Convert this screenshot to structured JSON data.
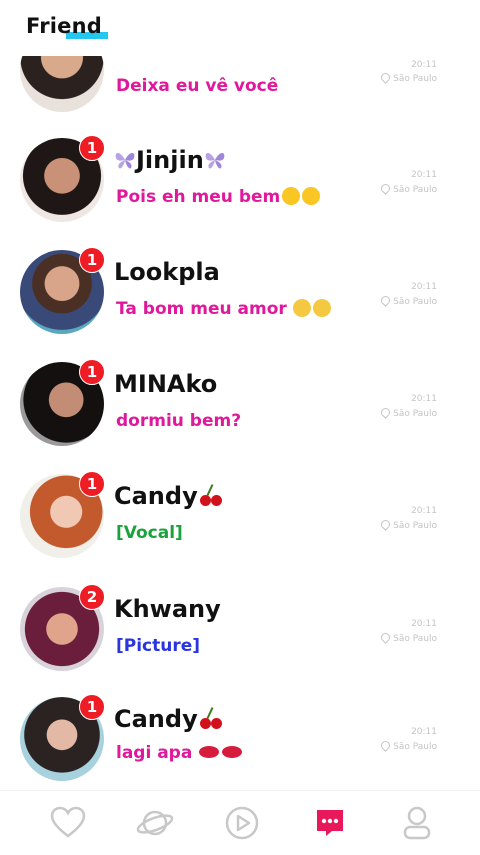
{
  "header": {
    "title": "Friend"
  },
  "conversations": [
    {
      "name": "",
      "message": "Deixa eu vê você",
      "message_color": "#e0189c",
      "time": "20:11",
      "location": "São Paulo",
      "badge": ""
    },
    {
      "name": "Jinjin",
      "message": "Pois eh meu bem",
      "message_color": "#e0189c",
      "time": "20:11",
      "location": "São Paulo",
      "badge": "1"
    },
    {
      "name": "Lookpla",
      "message": "Ta bom meu amor",
      "message_color": "#e0189c",
      "time": "20:11",
      "location": "São Paulo",
      "badge": "1"
    },
    {
      "name": "MINAko",
      "message": "dormiu bem?",
      "message_color": "#e0189c",
      "time": "20:11",
      "location": "São Paulo",
      "badge": "1"
    },
    {
      "name": "Candy",
      "message": "[Vocal]",
      "message_color": "#1aa33c",
      "time": "20:11",
      "location": "São Paulo",
      "badge": "1"
    },
    {
      "name": "Khwany",
      "message": "[Picture]",
      "message_color": "#2a35e0",
      "time": "20:11",
      "location": "São Paulo",
      "badge": "2"
    },
    {
      "name": "Candy",
      "message": "lagi apa",
      "message_color": "#e0189c",
      "time": "20:11",
      "location": "São Paulo",
      "badge": "1"
    }
  ],
  "tabbar": {
    "items": [
      {
        "icon": "heart-icon",
        "active": false
      },
      {
        "icon": "planet-icon",
        "active": false
      },
      {
        "icon": "play-icon",
        "active": false
      },
      {
        "icon": "chat-icon",
        "active": true
      },
      {
        "icon": "profile-icon",
        "active": false
      }
    ],
    "active_color": "#e8185a",
    "inactive_color": "#c8c8c8"
  }
}
